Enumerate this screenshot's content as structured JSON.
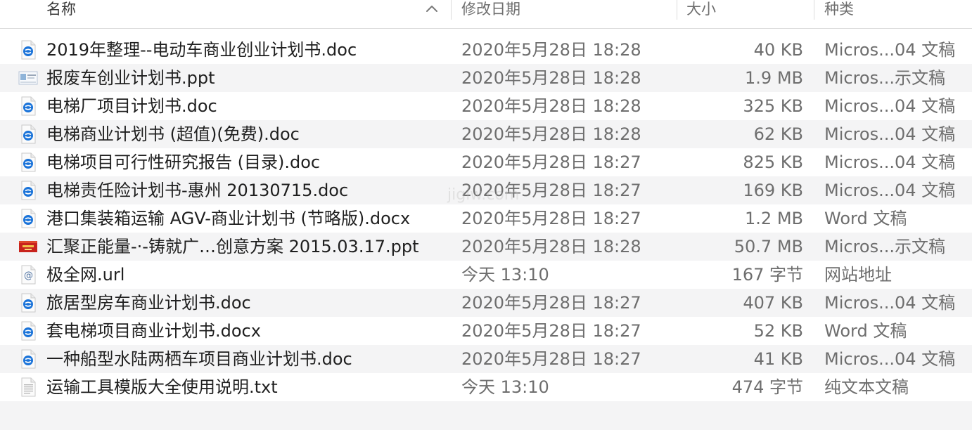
{
  "columns": {
    "name": "名称",
    "date": "修改日期",
    "size": "大小",
    "kind": "种类"
  },
  "sort": {
    "column": "name",
    "direction": "ascending",
    "icon": "chevron-up-icon"
  },
  "watermark": "jigiw.com",
  "colors": {
    "word_icon": "#1a73d9",
    "ppt_icon_bg": "#8fb4d9",
    "banner_red": "#c8231c",
    "row_alt": "#f4f4f5",
    "header_text": "#6e6e6e"
  },
  "files": [
    {
      "name": "2019年整理--电动车商业创业计划书.doc",
      "date": "2020年5月28日 18:28",
      "size": "40 KB",
      "kind": "Micros...04 文稿",
      "icon": "word-doc-icon"
    },
    {
      "name": "报废车创业计划书.ppt",
      "date": "2020年5月28日 18:28",
      "size": "1.9 MB",
      "kind": "Micros...示文稿",
      "icon": "ppt-thumbnail-icon"
    },
    {
      "name": "电梯厂项目计划书.doc",
      "date": "2020年5月28日 18:28",
      "size": "325 KB",
      "kind": "Micros...04 文稿",
      "icon": "word-doc-icon"
    },
    {
      "name": "电梯商业计划书 (超值)(免费).doc",
      "date": "2020年5月28日 18:28",
      "size": "62 KB",
      "kind": "Micros...04 文稿",
      "icon": "word-doc-icon"
    },
    {
      "name": "电梯项目可行性研究报告 (目录).doc",
      "date": "2020年5月28日 18:27",
      "size": "825 KB",
      "kind": "Micros...04 文稿",
      "icon": "word-doc-icon"
    },
    {
      "name": "电梯责任险计划书-惠州 20130715.doc",
      "date": "2020年5月28日 18:27",
      "size": "169 KB",
      "kind": "Micros...04 文稿",
      "icon": "word-doc-icon"
    },
    {
      "name": "港口集装箱运输 AGV-商业计划书 (节略版).docx",
      "date": "2020年5月28日 18:27",
      "size": "1.2 MB",
      "kind": "Word 文稿",
      "icon": "word-doc-icon"
    },
    {
      "name": "汇聚正能量-·-铸就广…创意方案 2015.03.17.ppt",
      "date": "2020年5月28日 18:28",
      "size": "50.7 MB",
      "kind": "Micros...示文稿",
      "icon": "red-banner-thumbnail-icon"
    },
    {
      "name": "极全网.url",
      "date": "今天 13:10",
      "size": "167 字节",
      "kind": "网站地址",
      "icon": "url-at-icon"
    },
    {
      "name": "旅居型房车商业计划书.doc",
      "date": "2020年5月28日 18:27",
      "size": "407 KB",
      "kind": "Micros...04 文稿",
      "icon": "word-doc-icon"
    },
    {
      "name": "套电梯项目商业计划书.docx",
      "date": "2020年5月28日 18:27",
      "size": "52 KB",
      "kind": "Word 文稿",
      "icon": "word-doc-icon"
    },
    {
      "name": "一种船型水陆两栖车项目商业计划书.doc",
      "date": "2020年5月28日 18:27",
      "size": "41 KB",
      "kind": "Micros...04 文稿",
      "icon": "word-doc-icon"
    },
    {
      "name": "运输工具模版大全使用说明.txt",
      "date": "今天 13:10",
      "size": "474 字节",
      "kind": "纯文本文稿",
      "icon": "text-file-icon"
    }
  ]
}
